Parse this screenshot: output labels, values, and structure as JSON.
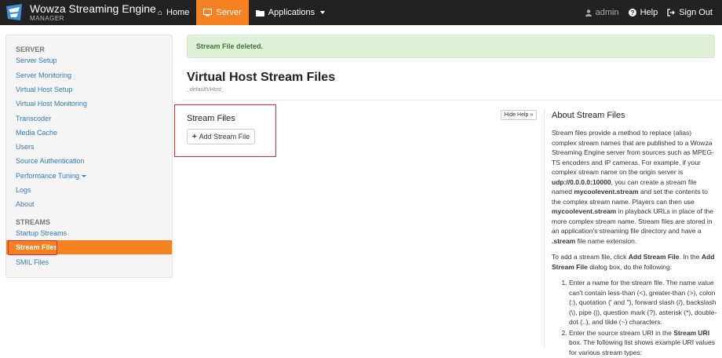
{
  "brand": {
    "name": "Wowza Streaming Engine",
    "sub": "MANAGER",
    "accent": "#f58220"
  },
  "nav": {
    "home": {
      "icon": "home-icon",
      "label": "Home"
    },
    "server": {
      "icon": "monitor-icon",
      "label": "Server"
    },
    "applications": {
      "icon": "folder-icon",
      "label": "Applications"
    },
    "user": {
      "icon": "user-icon",
      "label": "admin"
    },
    "help": {
      "icon": "question-icon",
      "label": "Help"
    },
    "signout": {
      "icon": "signout-icon",
      "label": "Sign Out"
    }
  },
  "sidebar": {
    "server_heading": "SERVER",
    "server_items": [
      "Server Setup",
      "Server Monitoring",
      "Virtual Host Setup",
      "Virtual Host Monitoring",
      "Transcoder",
      "Media Cache",
      "Users",
      "Source Authentication",
      "Performance Tuning",
      "Logs",
      "About"
    ],
    "streams_heading": "STREAMS",
    "streams_items": [
      "Startup Streams",
      "Stream Files",
      "SMIL Files"
    ]
  },
  "alert": {
    "text": "Stream File deleted."
  },
  "page": {
    "title": "Virtual Host Stream Files",
    "subtitle": "_defaultVHost_"
  },
  "section": {
    "title": "Stream Files",
    "add_button": "Add Stream File",
    "hide_help": "Hide Help »"
  },
  "help": {
    "title": "About Stream Files",
    "p1_a": "Stream files provide a method to replace (alias) complex stream names that are published to a Wowza Streaming Engine server from sources such as MPEG-TS encoders and IP cameras. For example, if your complex stream name on the origin server is ",
    "p1_b": "udp://0.0.0.0:10000",
    "p1_c": ", you can create a stream file named ",
    "p1_d": "mycoolevent.stream",
    "p1_e": " and set the contents to the complex stream name. Players can then use ",
    "p1_f": "mycoolevent.stream",
    "p1_g": " in playback URLs in place of the more complex stream name. Stream files are stored in an application's streaming file directory and have a ",
    "p1_h": ".stream",
    "p1_i": " file name extension.",
    "p2_a": "To add a stream file, click ",
    "p2_b": "Add Stream File",
    "p2_c": ". In the ",
    "p2_d": "Add Stream File",
    "p2_e": " dialog box, do the following:",
    "li1": "Enter a name for the stream file. The name value can't contain less-than (<), greater-than (>), colon (:), quotation (' and \"), forward slash (/), backslash (\\), pipe (|), question mark (?), asterisk (*), double-dot (..), and tilde (~) characters.",
    "li2_a": "Enter the source stream URI in the ",
    "li2_b": "Stream URI",
    "li2_c": " box. The following list shows example URI values for various stream types:"
  }
}
